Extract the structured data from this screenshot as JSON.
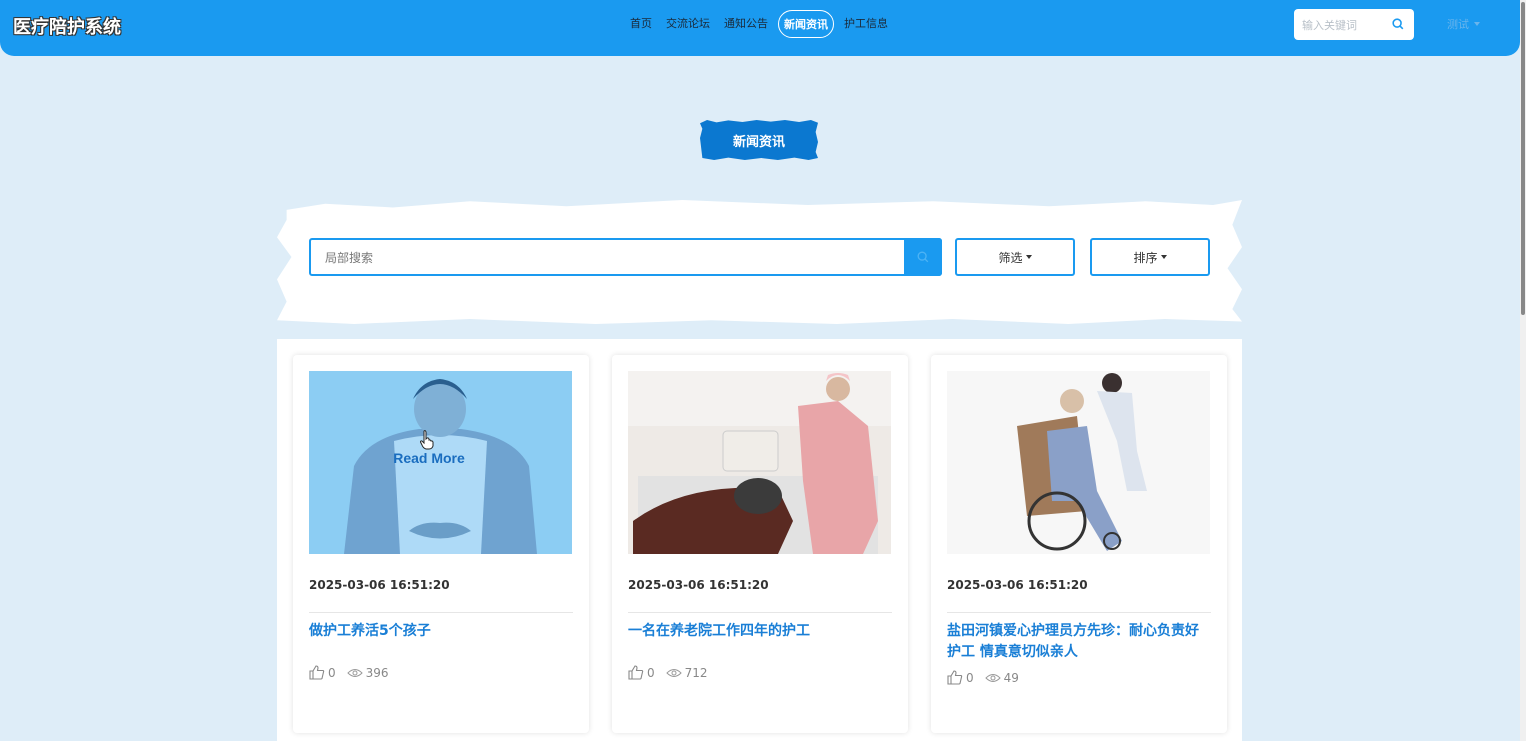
{
  "header": {
    "logo": "医疗陪护系统",
    "nav": [
      "首页",
      "交流论坛",
      "通知公告",
      "新闻资讯",
      "护工信息"
    ],
    "active_nav": "新闻资讯",
    "search_placeholder": "输入关键词",
    "user": "测试"
  },
  "page": {
    "section_title": "新闻资讯",
    "search_placeholder": "局部搜索",
    "filter_label": "筛选",
    "sort_label": "排序"
  },
  "cards": [
    {
      "date": "2025-03-06 16:51:20",
      "title": "做护工养活5个孩子",
      "likes": "0",
      "views": "396",
      "overlay": "Read More"
    },
    {
      "date": "2025-03-06 16:51:20",
      "title": "一名在养老院工作四年的护工",
      "likes": "0",
      "views": "712"
    },
    {
      "date": "2025-03-06 16:51:20",
      "title": "盐田河镇爱心护理员方先珍：耐心负责好护工 情真意切似亲人",
      "likes": "0",
      "views": "49"
    }
  ],
  "colors": {
    "primary": "#1a9af0",
    "background": "#deedf8",
    "title_blue": "#1a7fd6"
  }
}
